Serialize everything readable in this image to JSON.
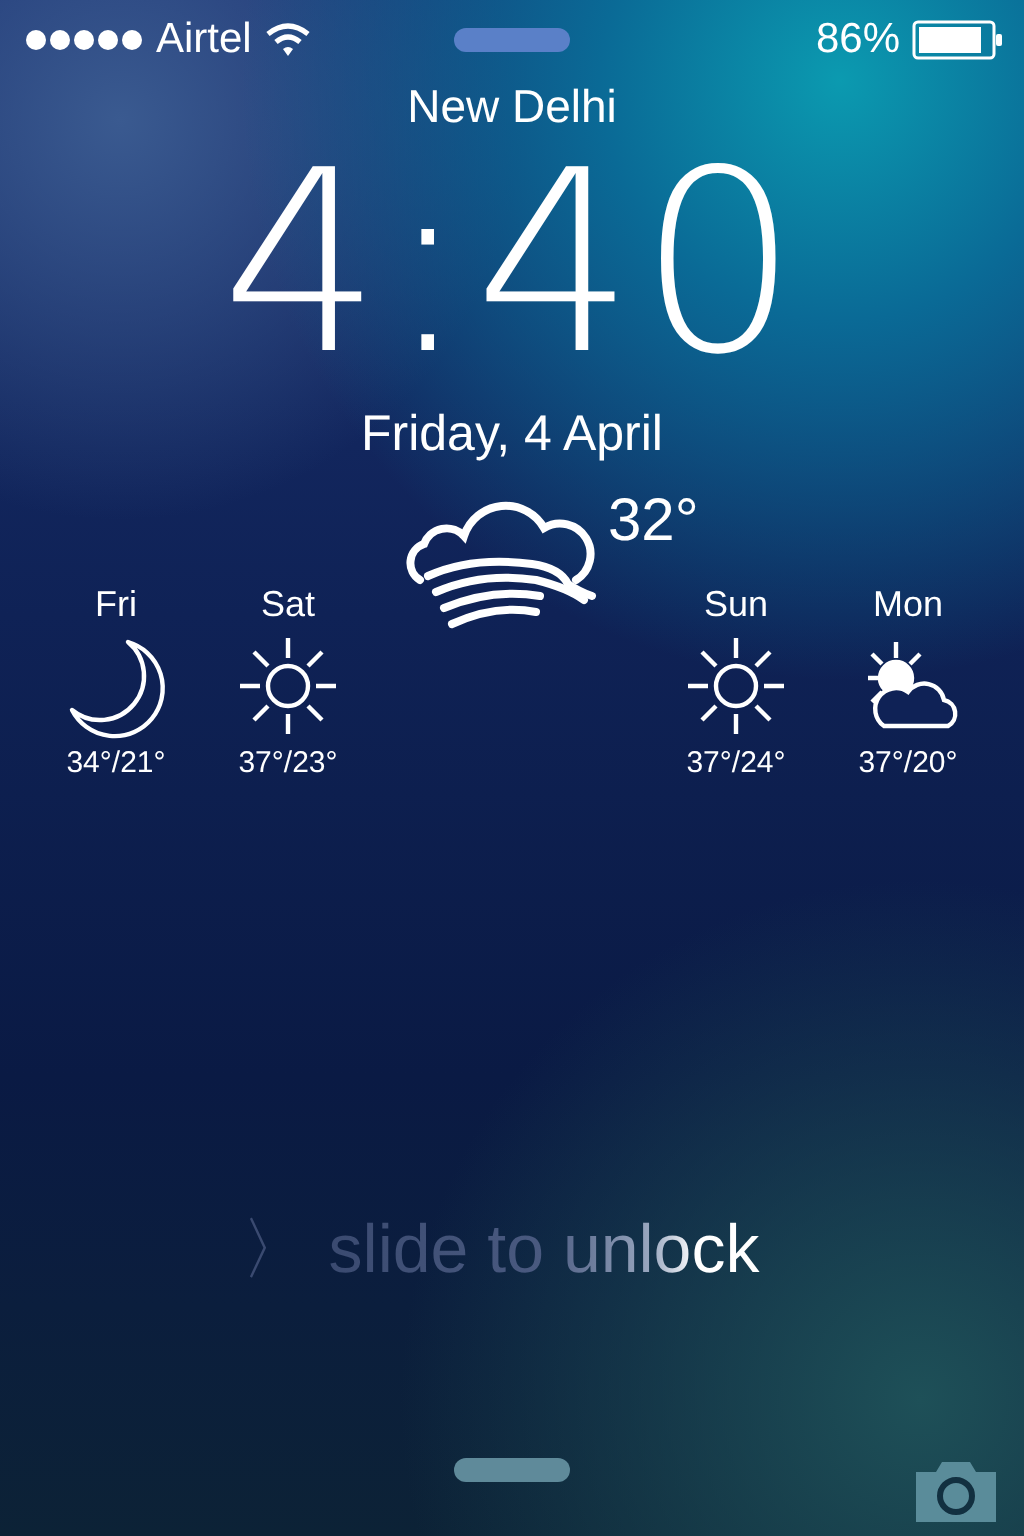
{
  "status_bar": {
    "carrier": "Airtel",
    "battery_percent": "86%"
  },
  "city": "New Delhi",
  "time": "4:40",
  "date": "Friday, 4 April",
  "current": {
    "kind": "windy-cloud",
    "temperature": "32°"
  },
  "forecast": [
    {
      "day": "Fri",
      "kind": "moon",
      "range": "34°/21°"
    },
    {
      "day": "Sat",
      "kind": "sun",
      "range": "37°/23°"
    },
    {
      "day": "Sun",
      "kind": "sun",
      "range": "37°/24°"
    },
    {
      "day": "Mon",
      "kind": "sun-cloud",
      "range": "37°/20°"
    }
  ],
  "unlock": {
    "arrow": "〉",
    "text": "slide to unlock"
  }
}
